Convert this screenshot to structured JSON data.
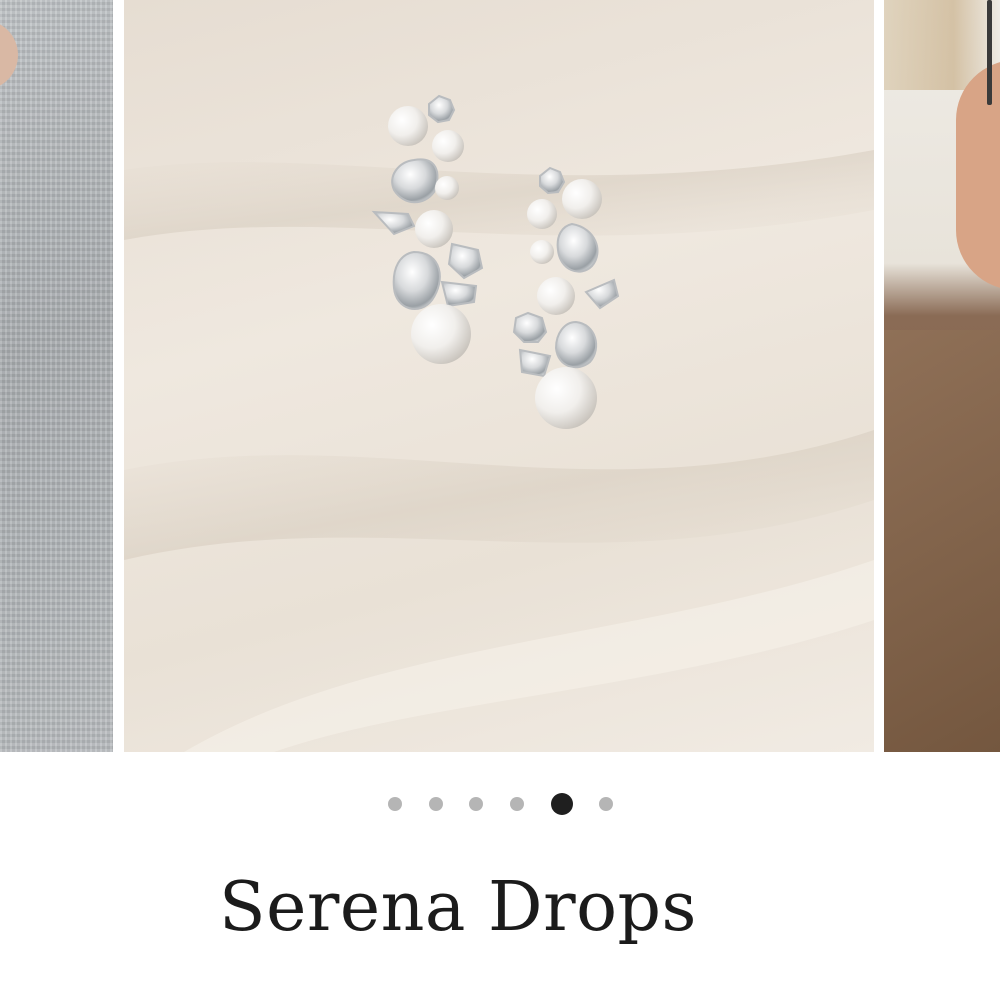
{
  "carousel": {
    "slide_count": 6,
    "active_index": 4
  },
  "product": {
    "title": "Serena Drops"
  },
  "zoom": {
    "icon": "magnify-icon"
  },
  "colors": {
    "dot_inactive": "#b5b5b5",
    "dot_active": "#1f1f1f",
    "title_text": "#1b1b1b"
  }
}
